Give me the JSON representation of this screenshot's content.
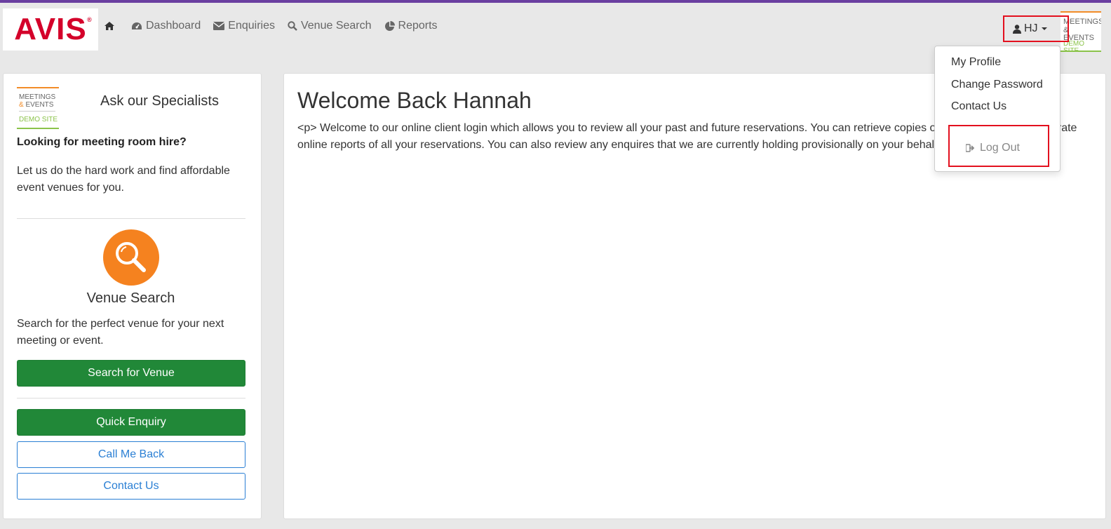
{
  "brand": {
    "name": "AVIS",
    "reg": "®"
  },
  "nav": {
    "home_icon": "home-icon",
    "items": [
      {
        "label": "Dashboard",
        "icon": "dashboard-icon"
      },
      {
        "label": "Enquiries",
        "icon": "envelope-icon"
      },
      {
        "label": "Venue Search",
        "icon": "search-icon"
      },
      {
        "label": "Reports",
        "icon": "pie-chart-icon"
      }
    ]
  },
  "user": {
    "initials": "HJ",
    "icon": "user-icon"
  },
  "corner_logo": {
    "line1": "MEETINGS",
    "line2": "& EVENTS",
    "line3": "DEMO SITE"
  },
  "dropdown": {
    "items": [
      "My Profile",
      "Change Password",
      "Contact Us"
    ],
    "logout": "Log Out"
  },
  "sidebar": {
    "logo": {
      "line1": "MEETINGS",
      "amp": "&",
      "line2": "EVENTS",
      "line3": "DEMO SITE"
    },
    "ask_title": "Ask our Specialists",
    "heading": "Looking for meeting room hire?",
    "text": "Let us do the hard work and find affordable event venues for you.",
    "venue_search_title": "Venue Search",
    "venue_search_text": "Search for the perfect venue for your next meeting or event.",
    "search_button": "Search for Venue",
    "quick_enquiry_button": "Quick Enquiry",
    "call_me_back_button": "Call Me Back",
    "contact_us_button": "Contact Us"
  },
  "main": {
    "title": "Welcome Back Hannah",
    "intro": "<p> Welcome to our online client login which allows you to review all your past and future reservations. You can retrieve copies of your invoices and generate online reports of all your reservations. You can also review any enquires that we are currently holding provisionally on your behalf."
  },
  "colors": {
    "accent_purple": "#6a3fa0",
    "avis_red": "#d4002a",
    "green_button": "#218838",
    "outline_blue": "#2a7fd4",
    "search_orange": "#f5821f",
    "highlight_red": "#e3101e"
  }
}
